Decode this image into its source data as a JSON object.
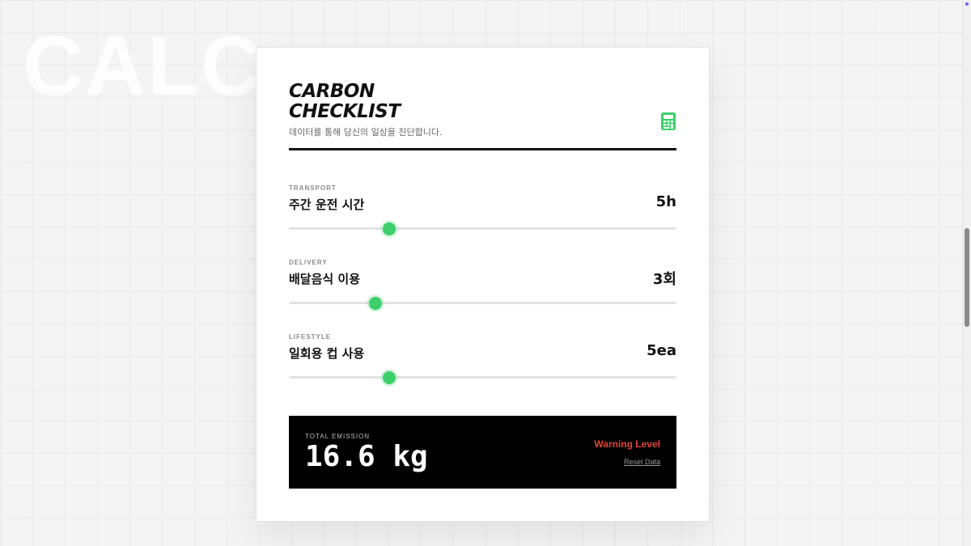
{
  "background": {
    "watermark": "CALC"
  },
  "header": {
    "title_line1": "CARBON",
    "title_line2": "CHECKLIST",
    "subtitle": "데이터를 통해 당신의 일상을 진단합니다.",
    "icon": "calculator-icon",
    "accent_color": "#3ccf6b"
  },
  "items": [
    {
      "category": "TRANSPORT",
      "label": "주간 운전 시간",
      "value": "5h",
      "level": 0.257
    },
    {
      "category": "DELIVERY",
      "label": "배달음식 이용",
      "value": "3회",
      "level": 0.222
    },
    {
      "category": "LIFESTYLE",
      "label": "일회용 컵 사용",
      "value": "5ea",
      "level": 0.257
    }
  ],
  "summary": {
    "label": "TOTAL EMISSION",
    "value": "16.6 kg",
    "status": "Warning Level",
    "status_color": "#e0453a",
    "reset_label": "Reset Data"
  }
}
